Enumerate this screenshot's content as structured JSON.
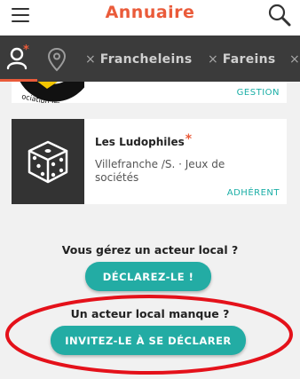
{
  "header": {
    "title": "Annuaire",
    "menu_icon": "hamburger-menu-icon",
    "search_icon": "search-icon"
  },
  "filters": {
    "user_icon": "user-filter-icon",
    "location_icon": "location-pin-icon",
    "chips": [
      {
        "remove": "×",
        "label": "Francheleins"
      },
      {
        "remove": "×",
        "label": "Fareins"
      },
      {
        "remove": "×",
        "label": ""
      }
    ]
  },
  "cards": [
    {
      "badge": "GESTION",
      "image_text": "ociation Imaginact"
    },
    {
      "title": "Les Ludophiles",
      "required_mark": "*",
      "description": "Villefranche /S. · Jeux de sociétés",
      "badge": "ADHÉRENT",
      "thumb_icon": "dice-icon"
    }
  ],
  "cta": {
    "manage_question": "Vous gérez un acteur local ?",
    "declare_button": "DÉCLAREZ-LE !",
    "missing_question": "Un acteur local manque ?",
    "invite_button": "INVITEZ-LE À SE DÉCLARER"
  },
  "colors": {
    "accent": "#ea5b3a",
    "teal": "#23aca4",
    "filterbar": "#3b3b3b",
    "annotation": "#e4111a"
  }
}
